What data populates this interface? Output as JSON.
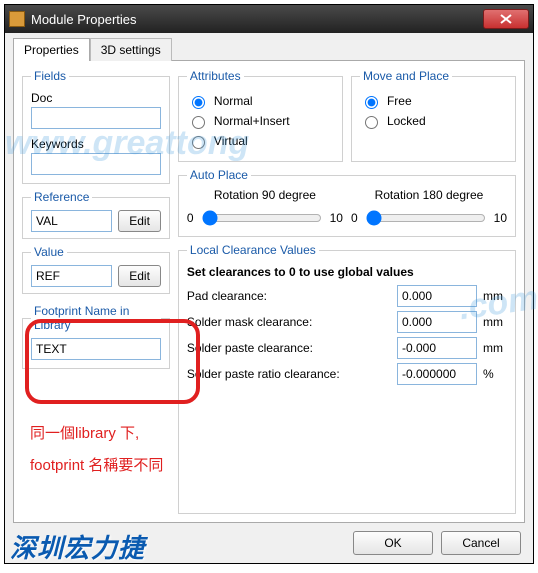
{
  "window": {
    "title": "Module Properties"
  },
  "tabs": {
    "properties": "Properties",
    "threeD": "3D settings"
  },
  "fields": {
    "legend": "Fields",
    "docLabel": "Doc",
    "docValue": "",
    "keywordsLabel": "Keywords",
    "keywordsValue": "",
    "referenceLabel": "Reference",
    "referenceValue": "VAL",
    "valueLabel": "Value",
    "valueValue": "REF",
    "editLabel": "Edit"
  },
  "footprint": {
    "legend": "Footprint Name in Library",
    "value": "TEXT"
  },
  "attributes": {
    "legend": "Attributes",
    "normal": "Normal",
    "normalInsert": "Normal+Insert",
    "virtual": "Virtual"
  },
  "movePlace": {
    "legend": "Move and Place",
    "free": "Free",
    "locked": "Locked"
  },
  "autoplace": {
    "legend": "Auto Place",
    "rot90": "Rotation 90 degree",
    "rot180": "Rotation 180 degree",
    "min": "0",
    "max": "10"
  },
  "clearance": {
    "legend": "Local Clearance Values",
    "hint": "Set clearances to 0 to use global values",
    "pad": {
      "label": "Pad clearance:",
      "value": "0.000",
      "unit": "mm"
    },
    "mask": {
      "label": "Solder mask clearance:",
      "value": "0.000",
      "unit": "mm"
    },
    "paste": {
      "label": "Solder paste clearance:",
      "value": "-0.000",
      "unit": "mm"
    },
    "ratio": {
      "label": "Solder paste ratio clearance:",
      "value": "-0.000000",
      "unit": "%"
    }
  },
  "footer": {
    "ok": "OK",
    "cancel": "Cancel"
  },
  "annotations": {
    "line1": "同一個library 下,",
    "line2": "footprint 名稱要不同",
    "wm1": "www.greattong",
    "wm2": ".com",
    "brand": "深圳宏力捷"
  }
}
